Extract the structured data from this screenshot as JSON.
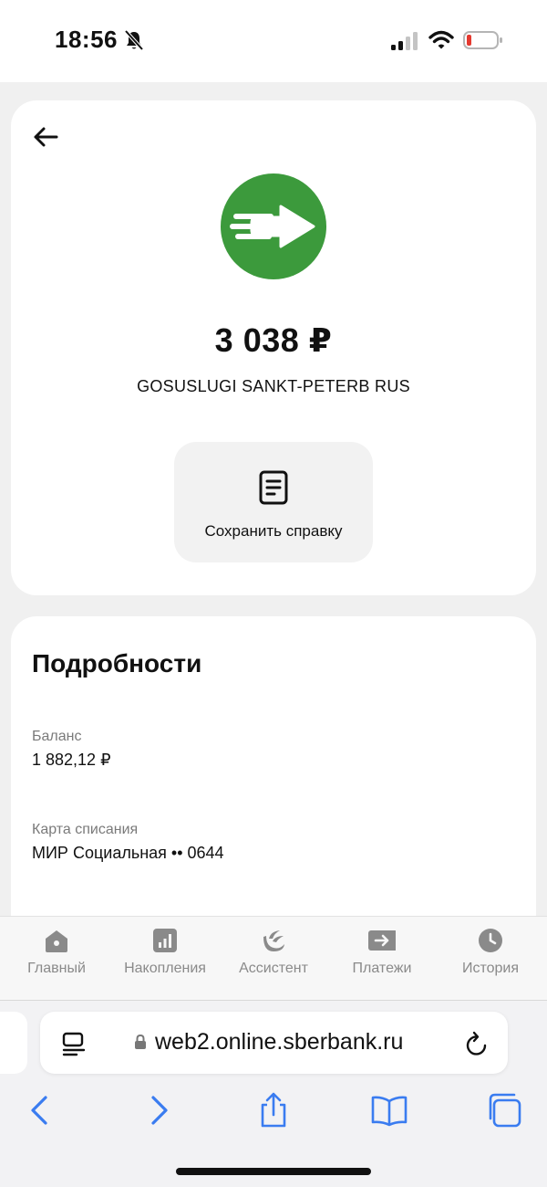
{
  "status_bar": {
    "time": "18:56",
    "icons": [
      "bell-slash-icon",
      "cellular-signal-icon",
      "wifi-icon",
      "battery-low-icon"
    ]
  },
  "transaction": {
    "amount": "3 038 ₽",
    "merchant": "GOSUSLUGI SANKT-PETERB RUS",
    "logo_icon": "transfer-arrow-icon",
    "logo_color": "#3c9a3c",
    "save_receipt_label": "Сохранить справку"
  },
  "details": {
    "title": "Подробности",
    "items": [
      {
        "label": "Баланс",
        "value": "1 882,12 ₽"
      },
      {
        "label": "Карта списания",
        "value": "МИР Социальная •• 0644"
      }
    ]
  },
  "bottom_nav": {
    "items": [
      {
        "label": "Главный",
        "icon": "home-icon"
      },
      {
        "label": "Накопления",
        "icon": "savings-chart-icon"
      },
      {
        "label": "Ассистент",
        "icon": "assistant-icon"
      },
      {
        "label": "Платежи",
        "icon": "payments-icon"
      },
      {
        "label": "История",
        "icon": "history-clock-icon"
      }
    ]
  },
  "browser": {
    "url": "web2.online.sberbank.ru",
    "toolbar": [
      "back-icon",
      "forward-icon",
      "share-icon",
      "bookmarks-icon",
      "tabs-icon"
    ]
  }
}
